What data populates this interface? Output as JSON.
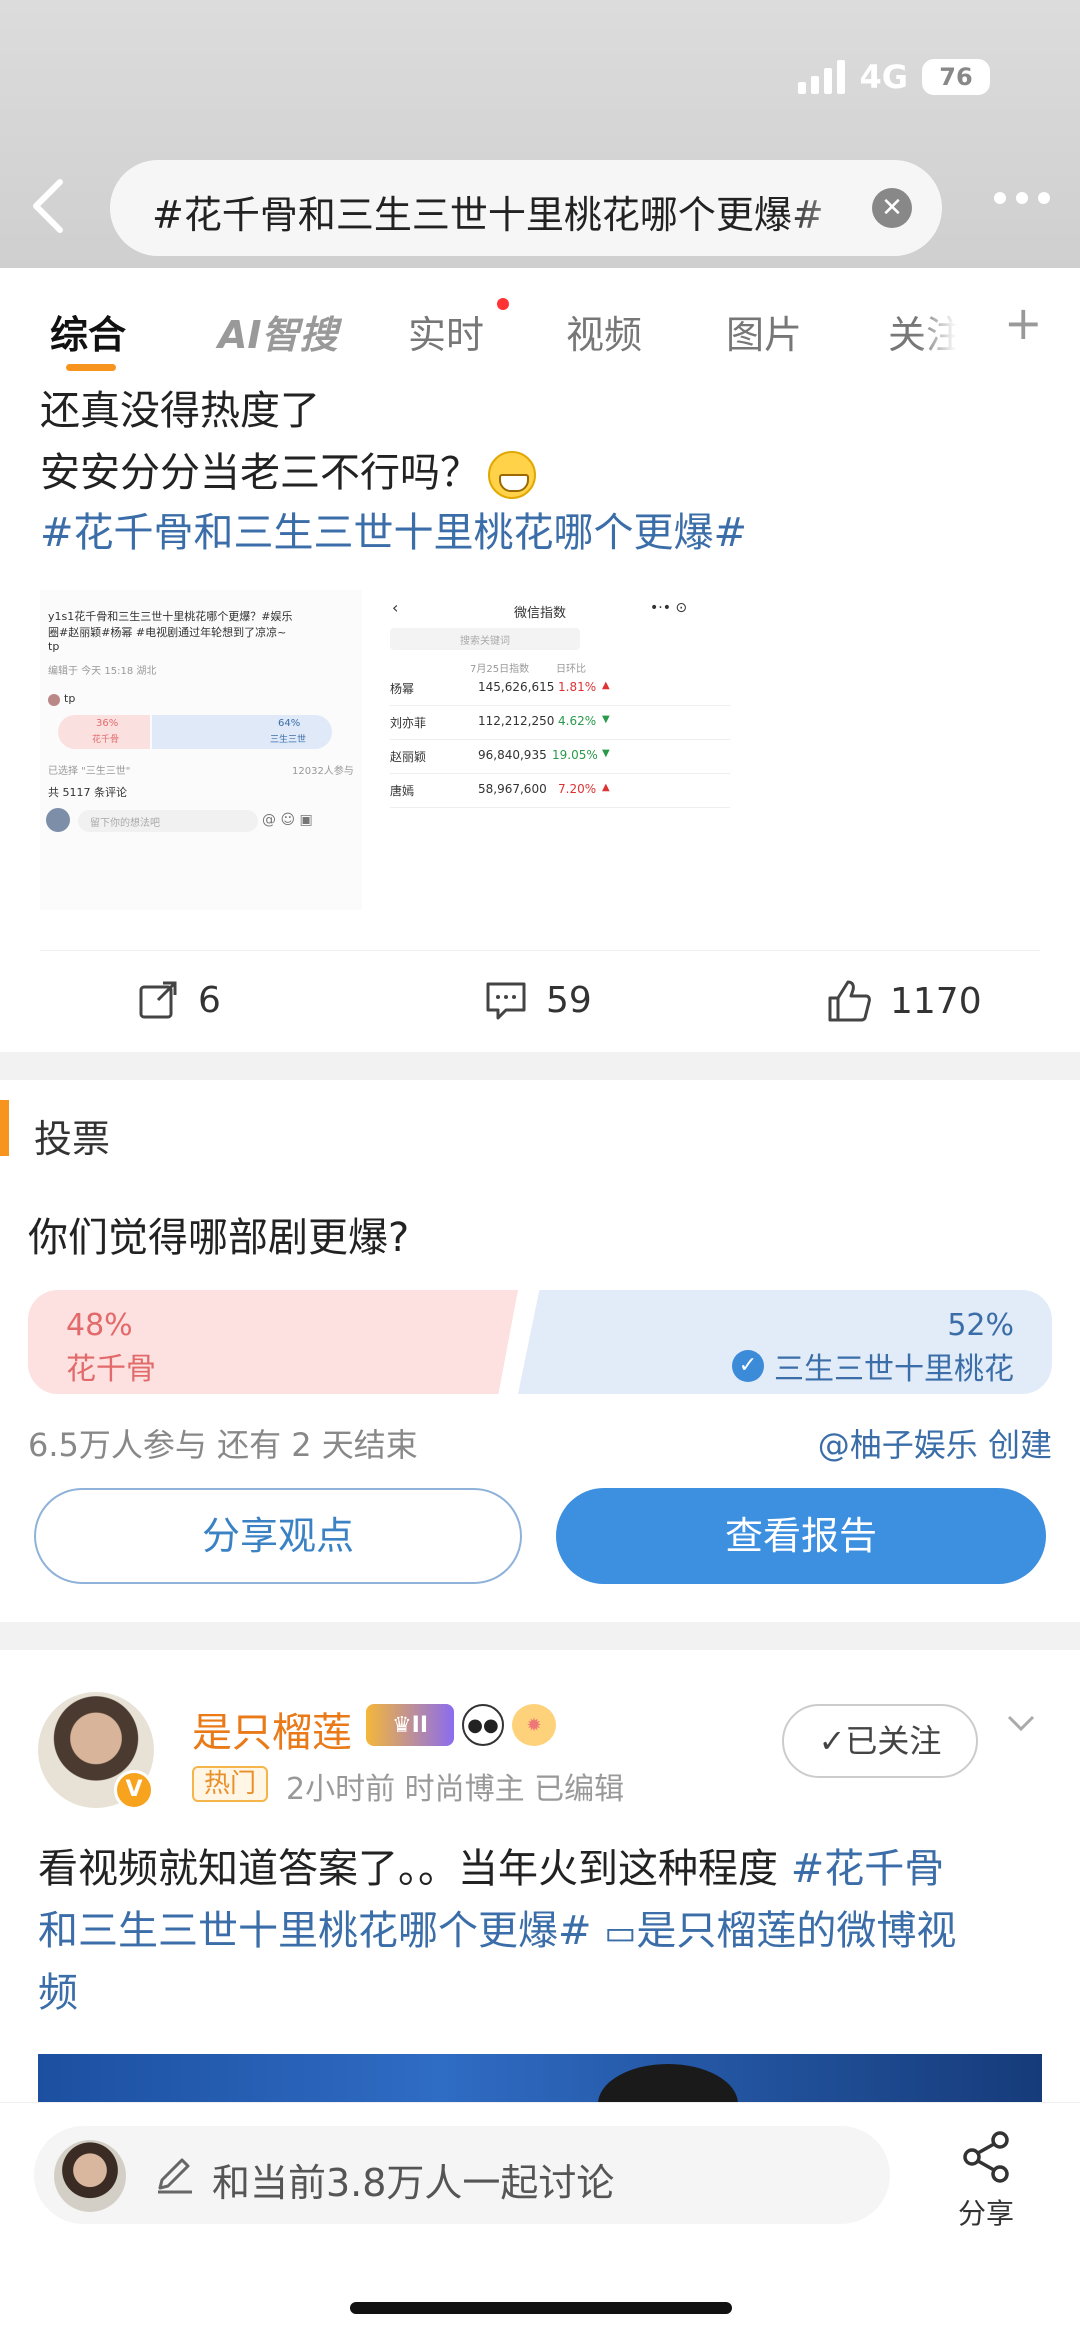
{
  "status": {
    "network": "4G",
    "battery": "76"
  },
  "search": {
    "query": "#花千骨和三生三世十里桃花哪个更爆#"
  },
  "tabs": [
    "综合",
    "AI智搜",
    "实时",
    "视频",
    "图片",
    "关注"
  ],
  "post1": {
    "line1": "还真没得热度了",
    "line2": "安安分分当老三不行吗？",
    "topic": "#花千骨和三生三世十里桃花哪个更爆#",
    "embed_left": {
      "title1": "y1s1花千骨和三生三世十里桃花哪个更爆？#娱乐",
      "title2": "圈#赵丽颖#杨幂 #电视剧通过年轮想到了凉凉~",
      "title3": "tp",
      "meta": "编辑于 今天 15:18 湖北",
      "user": "tp",
      "opt1_pct": "36%",
      "opt1_lbl": "花千骨",
      "opt2_pct": "64%",
      "opt2_lbl": "三生三世",
      "chosen": "已选择 \"三生三世\"",
      "participants": "12032人参与",
      "comments": "共 5117 条评论",
      "input": "留下你的想法吧"
    },
    "embed_right": {
      "title": "微信指数",
      "search_placeholder": "搜索关键词",
      "col_date": "7月25日指数",
      "col_change": "日环比",
      "rows": [
        {
          "name": "杨幂",
          "value": "145,626,615",
          "change": "1.81%",
          "dir": "up"
        },
        {
          "name": "刘亦菲",
          "value": "112,212,250",
          "change": "4.62%",
          "dir": "down"
        },
        {
          "name": "赵丽颖",
          "value": "96,840,935",
          "change": "19.05%",
          "dir": "down"
        },
        {
          "name": "唐嫣",
          "value": "58,967,600",
          "change": "7.20%",
          "dir": "up"
        }
      ]
    },
    "reposts": "6",
    "comments": "59",
    "likes": "1170"
  },
  "poll": {
    "header": "投票",
    "question": "你们觉得哪部剧更爆?",
    "option_a": {
      "pct": "48%",
      "label": "花千骨",
      "value": 48
    },
    "option_b": {
      "pct": "52%",
      "label": "三生三世十里桃花",
      "value": 52,
      "selected": true
    },
    "meta": "6.5万人参与  还有 2 天结束",
    "creator": "@柚子娱乐",
    "creator_suffix": " 创建",
    "share_btn": "分享观点",
    "report_btn": "查看报告"
  },
  "post2": {
    "username": "是只榴莲",
    "level": "II",
    "hot_tag": "热门",
    "meta": "2小时前  时尚博主  已编辑",
    "follow": "✓已关注",
    "line1a": "看视频就知道答案了。。当年火到这种程度 ",
    "line1b": "#花千骨",
    "line2": "和三生三世十里桃花哪个更爆# ",
    "line2b": "是只榴莲的微博视",
    "line3": "频"
  },
  "bottom": {
    "discuss": "和当前3.8万人一起讨论",
    "share": "分享"
  },
  "colors": {
    "accent": "#f7941d",
    "link": "#3b6ea8",
    "primary_btn": "#3d8fe0",
    "poll_a": "#fde0e0",
    "poll_b": "#e2ecf8"
  }
}
